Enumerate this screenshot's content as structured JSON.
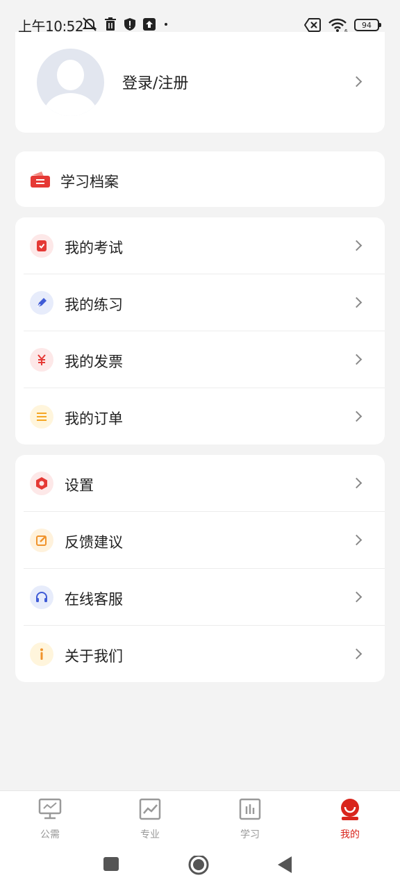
{
  "status_bar": {
    "time": "上午10:52",
    "battery": "94",
    "icons": [
      "mute-alarm-icon",
      "trash-icon",
      "shield-icon",
      "upload-icon",
      "dot-icon",
      "sim-off-icon",
      "wifi-icon",
      "battery-icon"
    ]
  },
  "profile": {
    "login_label": "登录/注册"
  },
  "archive": {
    "label": "学习档案"
  },
  "menu_group_1": [
    {
      "label": "我的考试",
      "icon": "exam-icon"
    },
    {
      "label": "我的练习",
      "icon": "pen-icon"
    },
    {
      "label": "我的发票",
      "icon": "yen-icon"
    },
    {
      "label": "我的订单",
      "icon": "list-icon"
    }
  ],
  "menu_group_2": [
    {
      "label": "设置",
      "icon": "settings-icon"
    },
    {
      "label": "反馈建议",
      "icon": "edit-icon"
    },
    {
      "label": "在线客服",
      "icon": "headset-icon"
    },
    {
      "label": "关于我们",
      "icon": "info-icon"
    }
  ],
  "tabbar": [
    {
      "label": "公需",
      "icon": "presentation-icon"
    },
    {
      "label": "专业",
      "icon": "trend-chart-icon"
    },
    {
      "label": "学习",
      "icon": "bar-chart-icon"
    },
    {
      "label": "我的",
      "icon": "profile-icon",
      "active": true
    }
  ],
  "colors": {
    "accent": "#d9251c",
    "background": "#f3f3f3",
    "inactive_tab": "#999999"
  }
}
